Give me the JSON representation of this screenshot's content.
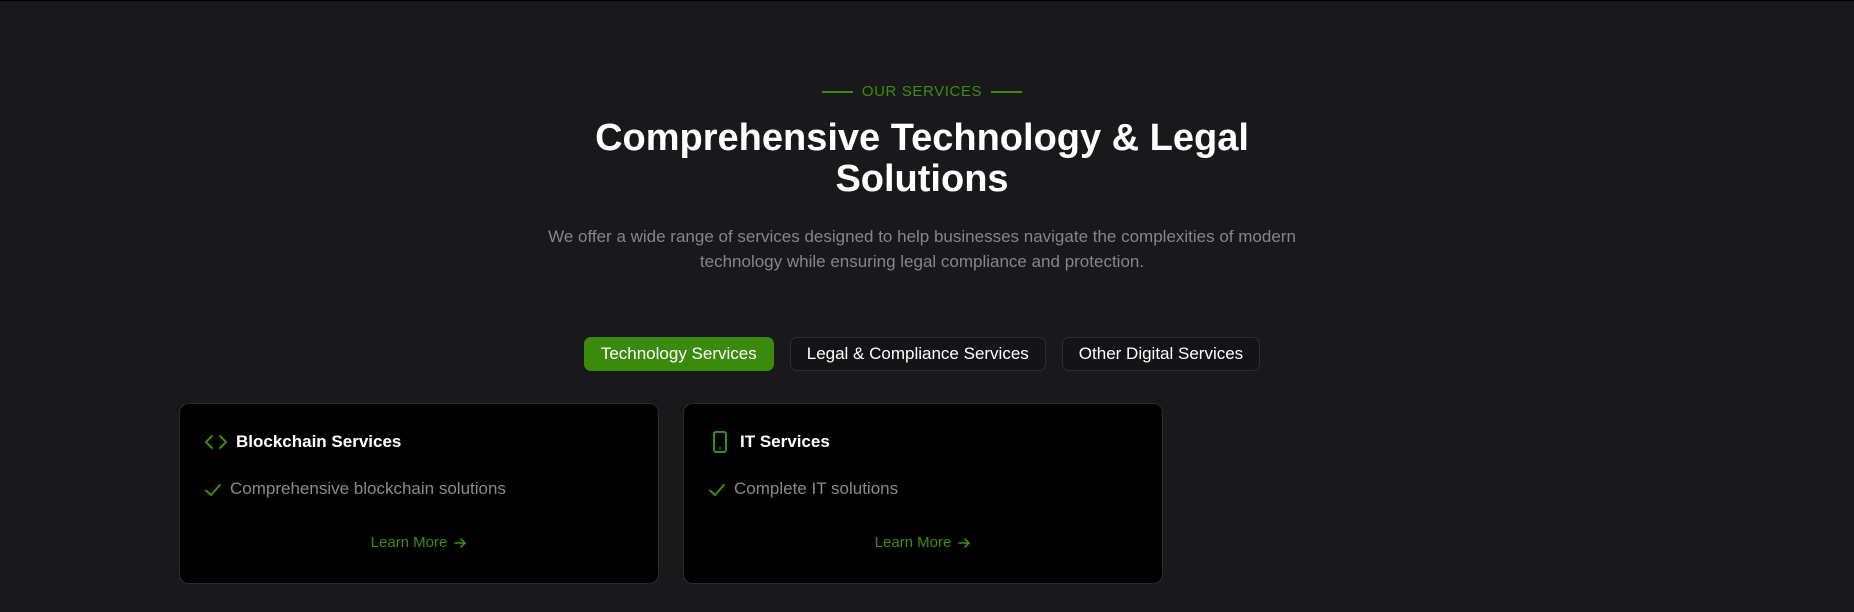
{
  "section": {
    "eyebrow": "OUR SERVICES",
    "title": "Comprehensive Technology & Legal Solutions",
    "subtitle": "We offer a wide range of services designed to help businesses navigate the complexities of modern technology while ensuring legal compliance and protection."
  },
  "tabs": [
    {
      "label": "Technology Services",
      "active": true
    },
    {
      "label": "Legal & Compliance Services",
      "active": false
    },
    {
      "label": "Other Digital Services",
      "active": false
    }
  ],
  "cards": [
    {
      "icon": "code-icon",
      "title": "Blockchain Services",
      "feature_icon": "check-icon",
      "feature": "Comprehensive blockchain solutions",
      "link_label": "Learn More",
      "link_icon": "arrow-right-icon"
    },
    {
      "icon": "smartphone-icon",
      "title": "IT Services",
      "feature_icon": "check-icon",
      "feature": "Complete IT solutions",
      "link_label": "Learn More",
      "link_icon": "arrow-right-icon"
    }
  ],
  "colors": {
    "background": "#19191b",
    "accent": "#3a8d12",
    "card_background": "#000000",
    "muted_text": "#86868a"
  }
}
